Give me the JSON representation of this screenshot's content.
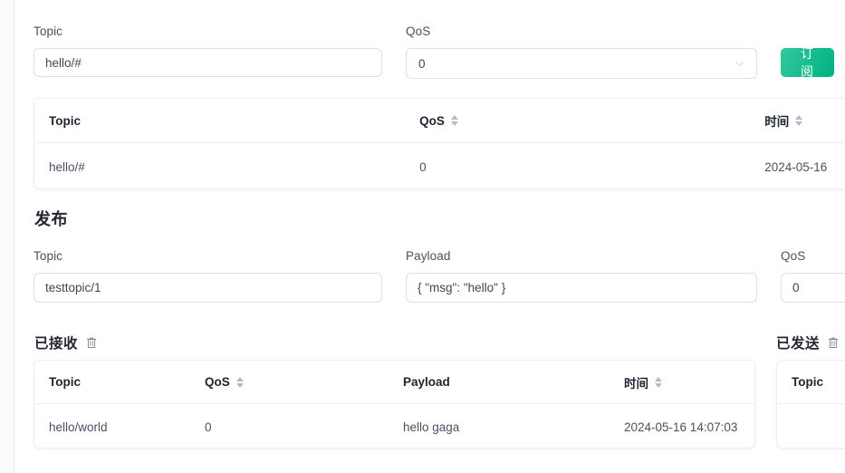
{
  "subscribe_form": {
    "topic_label": "Topic",
    "topic_value": "hello/#",
    "qos_label": "QoS",
    "qos_value": "0",
    "submit_label": "订阅"
  },
  "subscriptions_table": {
    "headers": {
      "topic": "Topic",
      "qos": "QoS",
      "time": "时间"
    },
    "rows": [
      {
        "topic": "hello/#",
        "qos": "0",
        "time": "2024-05-16"
      }
    ]
  },
  "publish_section": {
    "title": "发布",
    "topic_label": "Topic",
    "topic_value": "testtopic/1",
    "payload_label": "Payload",
    "payload_value": "{ \"msg\": \"hello\" }",
    "qos_label": "QoS",
    "qos_value": "0"
  },
  "received_panel": {
    "title": "已接收",
    "clear_icon": "trash-icon",
    "headers": {
      "topic": "Topic",
      "qos": "QoS",
      "payload": "Payload",
      "time": "时间"
    },
    "rows": [
      {
        "topic": "hello/world",
        "qos": "0",
        "payload": "hello gaga",
        "time": "2024-05-16 14:07:03"
      }
    ]
  },
  "sent_panel": {
    "title": "已发送",
    "clear_icon": "trash-icon",
    "headers": {
      "topic": "Topic"
    },
    "rows": []
  },
  "icons": {
    "chevron_down": "chevron-down-icon",
    "sort": "sort-arrows-icon"
  },
  "colors": {
    "primary": "#00b181",
    "primary_light": "#33c89d",
    "border": "#dcdfe6",
    "text": "#3c4149",
    "heading": "#23272f"
  }
}
